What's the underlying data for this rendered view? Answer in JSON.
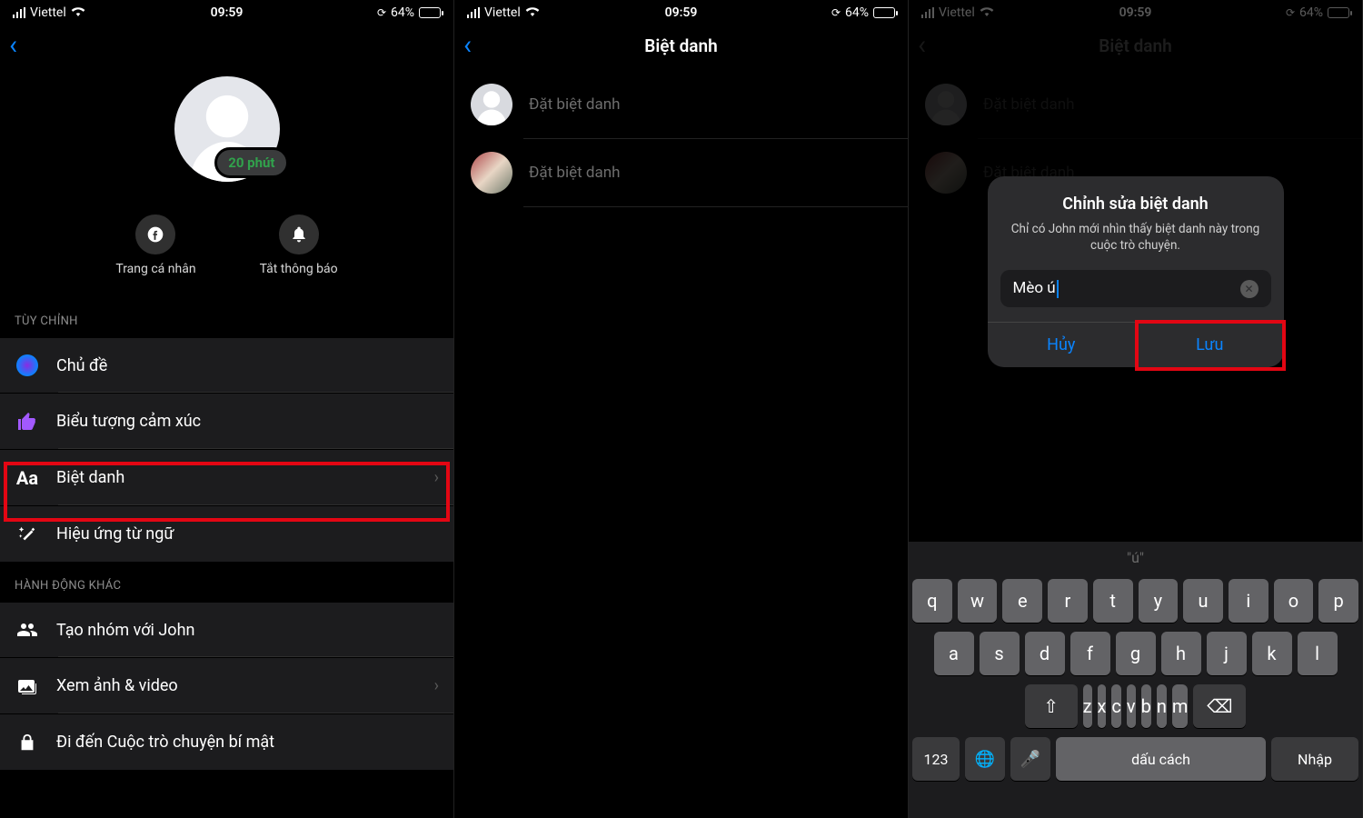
{
  "status": {
    "carrier": "Viettel",
    "time": "09:59",
    "battery_pct": "64%"
  },
  "screen1": {
    "status_pill": "20 phút",
    "actions": {
      "profile": "Trang cá nhân",
      "mute": "Tắt thông báo"
    },
    "section_customize": "TÙY CHỈNH",
    "rows": {
      "theme": "Chủ đề",
      "emoji": "Biểu tượng cảm xúc",
      "nickname": "Biệt danh",
      "word_effects": "Hiệu ứng từ ngữ"
    },
    "section_more": "HÀNH ĐỘNG KHÁC",
    "rows_more": {
      "create_group": "Tạo nhóm với John",
      "view_media": "Xem ảnh & video",
      "secret_convo": "Đi đến Cuộc trò chuyện bí mật"
    }
  },
  "screen2": {
    "title": "Biệt danh",
    "placeholder_nick": "Đặt biệt danh"
  },
  "screen3": {
    "title": "Biệt danh",
    "placeholder_nick": "Đặt biệt danh",
    "dialog": {
      "title": "Chỉnh sửa biệt danh",
      "subtitle": "Chỉ có John mới nhìn thấy biệt danh này trong cuộc trò chuyện.",
      "input_value": "Mèo ú",
      "cancel": "Hủy",
      "save": "Lưu"
    },
    "keyboard": {
      "suggestion": "\"ú\"",
      "row1": [
        "q",
        "w",
        "e",
        "r",
        "t",
        "y",
        "u",
        "i",
        "o",
        "p"
      ],
      "row2": [
        "a",
        "s",
        "d",
        "f",
        "g",
        "h",
        "j",
        "k",
        "l"
      ],
      "row3": [
        "z",
        "x",
        "c",
        "v",
        "b",
        "n",
        "m"
      ],
      "shift_glyph": "⇧",
      "backspace_glyph": "⌫",
      "numbers": "123",
      "globe": "🌐",
      "mic": "🎤",
      "space": "dấu cách",
      "enter": "Nhập"
    }
  }
}
